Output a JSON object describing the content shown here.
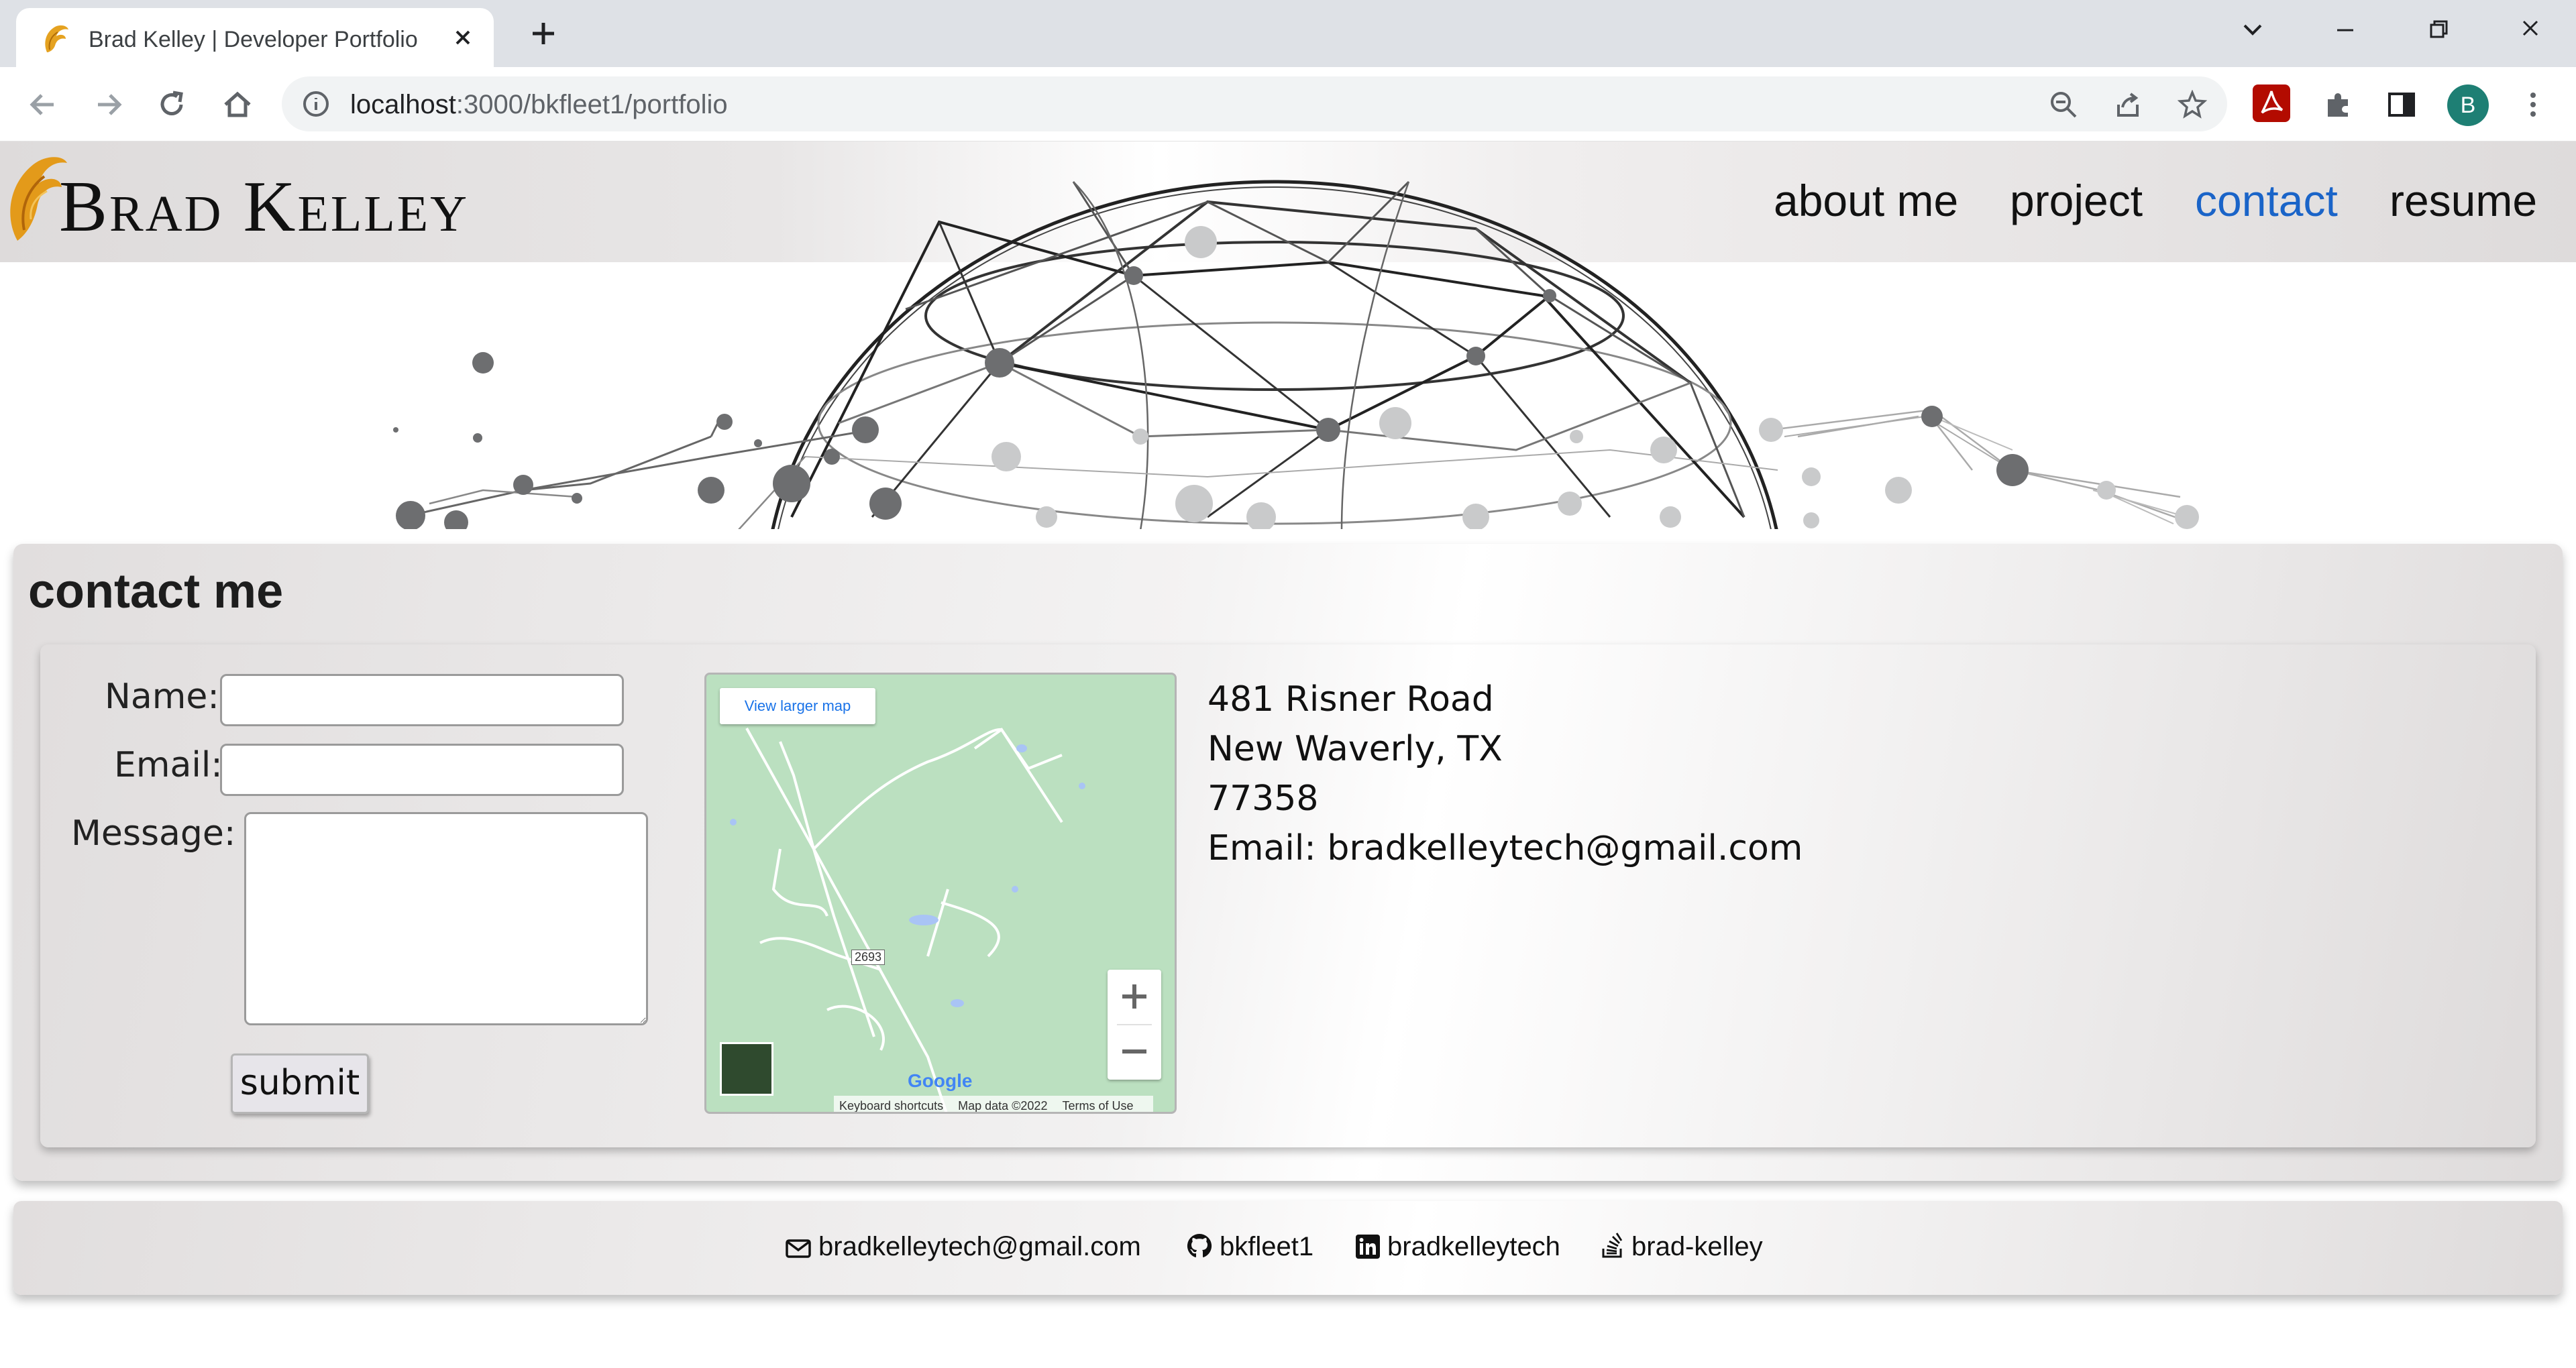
{
  "browser": {
    "tab_title": "Brad Kelley | Developer Portfolio",
    "url_host": "localhost",
    "url_rest": ":3000/bkfleet1/portfolio",
    "profile_initial": "B"
  },
  "site": {
    "logo_text": "Brad Kelley",
    "nav": [
      "about me",
      "project",
      "contact",
      "resume"
    ],
    "active_nav": "contact",
    "accent_color": "#1a64c8"
  },
  "contact": {
    "heading": "contact me",
    "form": {
      "name_label": "Name:",
      "email_label": "Email:",
      "message_label": "Message:",
      "name_value": "",
      "email_value": "",
      "message_value": "",
      "submit_label": "submit"
    },
    "map": {
      "view_larger": "View larger map",
      "road_label": "2693",
      "google": "Google",
      "footer": [
        "Keyboard shortcuts",
        "Map data ©2022",
        "Terms of Use"
      ]
    },
    "address": {
      "line1": "481 Risner Road",
      "line2": "New Waverly, TX",
      "line3": "77358",
      "email_line": "Email: bradkelleytech@gmail.com"
    }
  },
  "footer": {
    "email": "bradkelleytech@gmail.com",
    "github": "bkfleet1",
    "linkedin": "bradkelleytech",
    "stackoverflow": "brad-kelley"
  }
}
